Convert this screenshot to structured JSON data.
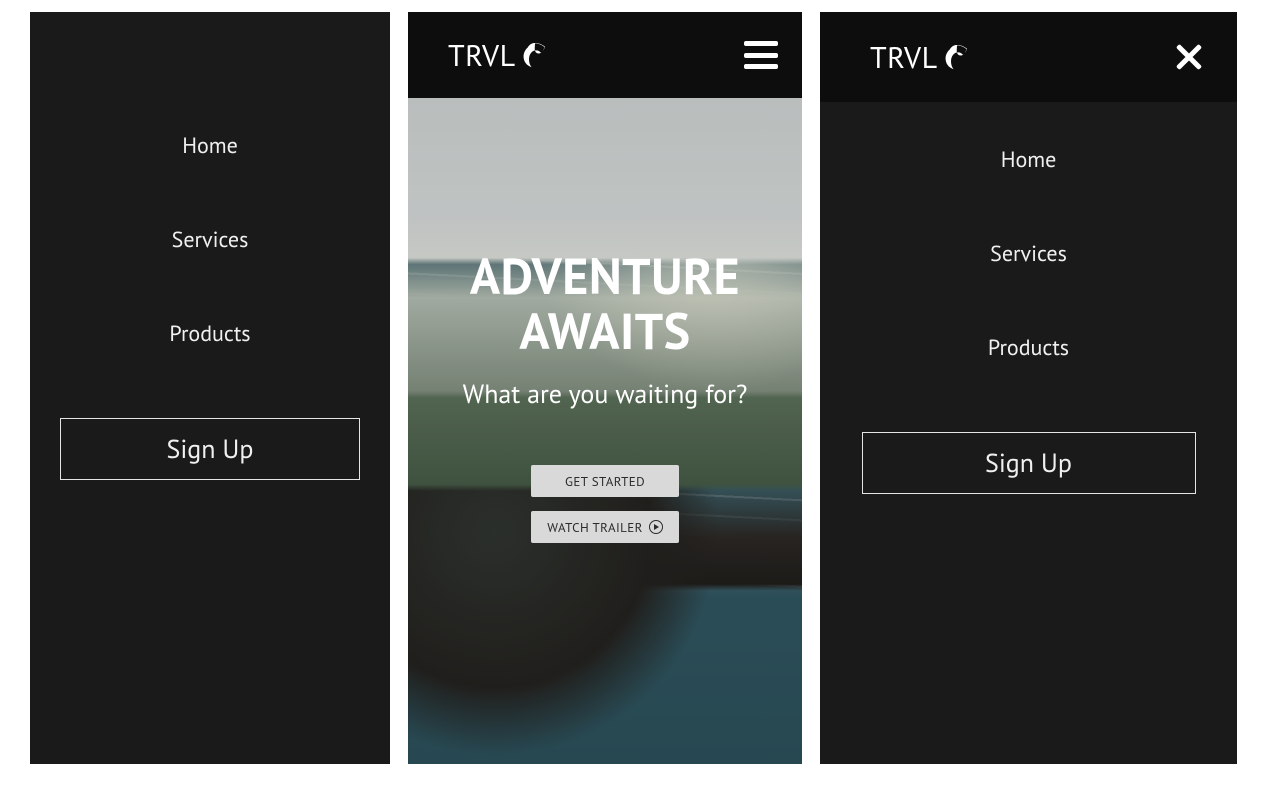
{
  "brand": {
    "name": "TRVL"
  },
  "nav": {
    "items": [
      "Home",
      "Services",
      "Products"
    ],
    "signup": "Sign Up"
  },
  "hero": {
    "title": "ADVENTURE AWAITS",
    "subtitle": "What are you waiting for?",
    "cta_primary": "GET STARTED",
    "cta_secondary": "WATCH TRAILER"
  }
}
